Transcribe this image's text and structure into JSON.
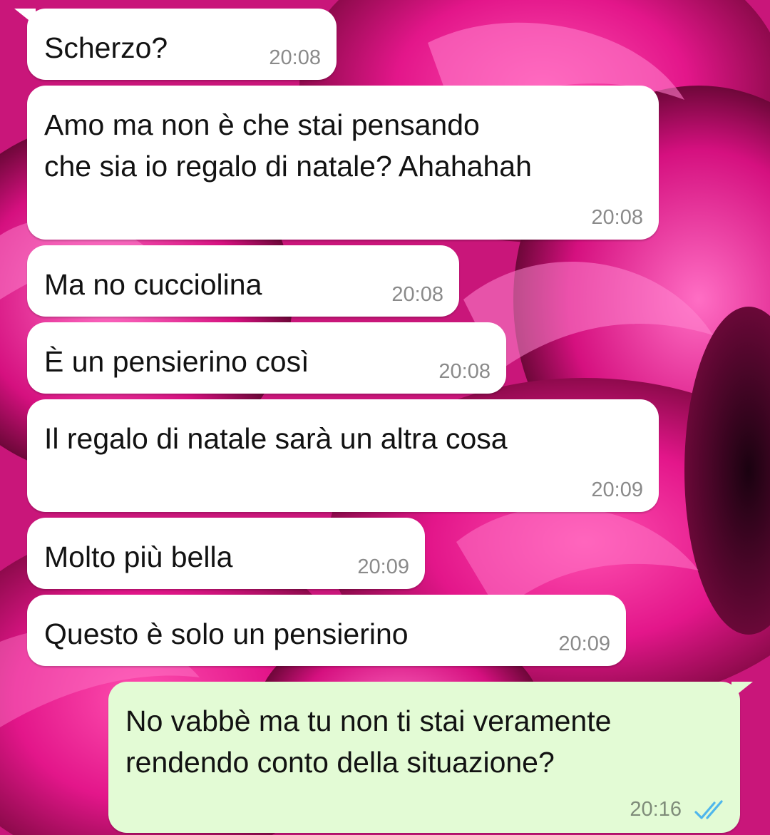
{
  "colors": {
    "incoming_bubble": "#ffffff",
    "outgoing_bubble": "#e3fbd5",
    "read_tick": "#4fb6ec",
    "wallpaper_base": "#c2126f"
  },
  "messages": [
    {
      "direction": "incoming",
      "text": "Scherzo?",
      "time": "20:08"
    },
    {
      "direction": "incoming",
      "text": "Amo ma non è che stai pensando\nche sia io regalo di natale? Ahahahah",
      "time": "20:08"
    },
    {
      "direction": "incoming",
      "text": "Ma no cucciolina",
      "time": "20:08"
    },
    {
      "direction": "incoming",
      "text": "È un pensierino così",
      "time": "20:08"
    },
    {
      "direction": "incoming",
      "text": "Il regalo di natale sarà un altra cosa",
      "time": "20:09"
    },
    {
      "direction": "incoming",
      "text": "Molto più bella",
      "time": "20:09"
    },
    {
      "direction": "incoming",
      "text": "Questo è solo un pensierino",
      "time": "20:09"
    },
    {
      "direction": "outgoing",
      "text": "No vabbè ma tu non ti stai veramente\nrendendo conto della situazione?",
      "time": "20:16",
      "status_icon": "double-check-icon",
      "status": "read"
    }
  ]
}
